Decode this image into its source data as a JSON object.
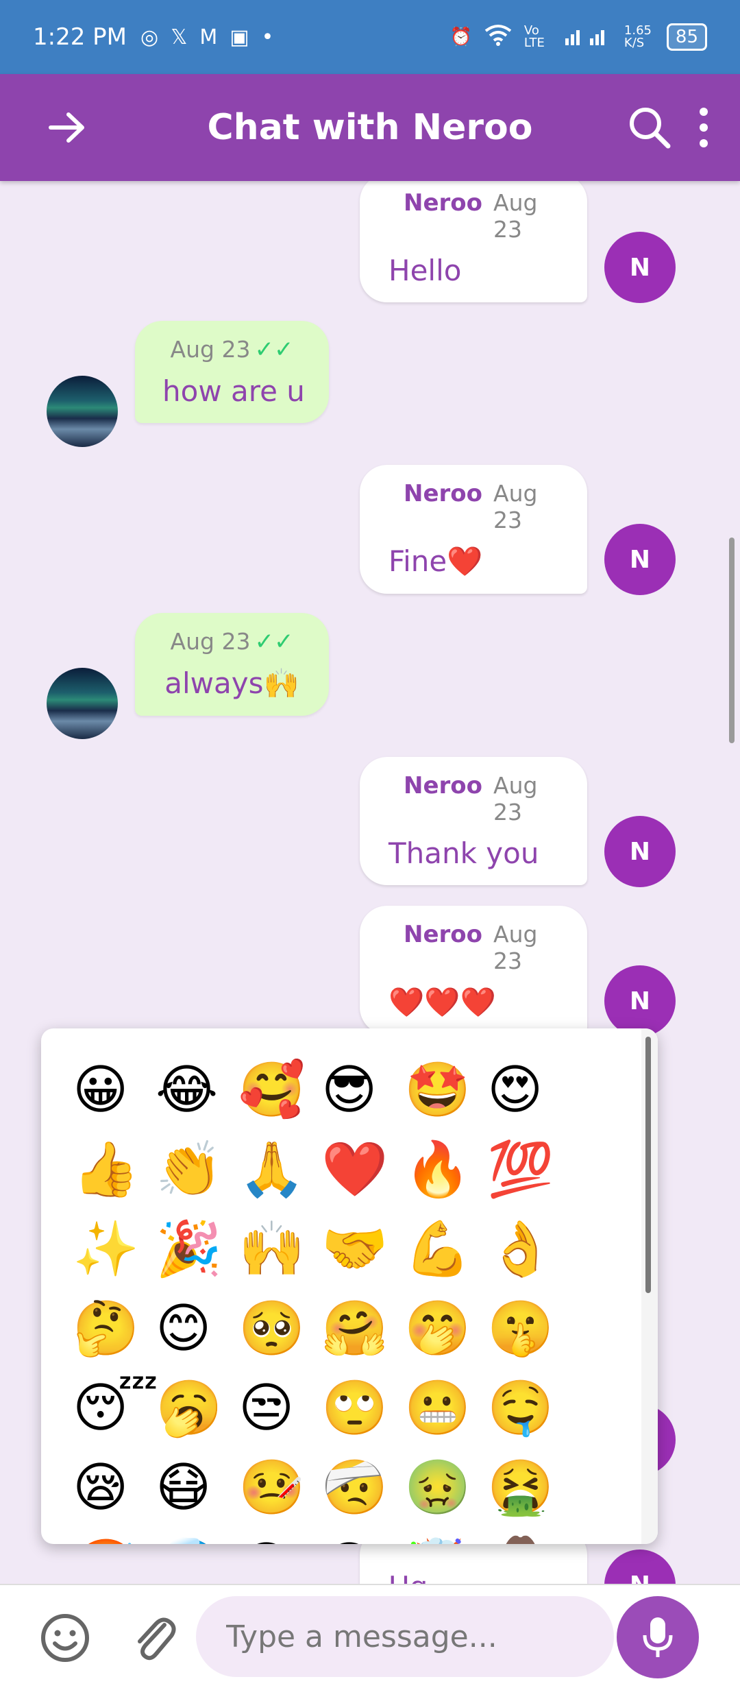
{
  "status_bar": {
    "time": "1:22 PM",
    "network": "Vo LTE",
    "speed": "1.65 K/S",
    "battery": "85"
  },
  "app_bar": {
    "title": "Chat with Neroo"
  },
  "messages": [
    {
      "type": "out",
      "sender": "Neroo",
      "date": "Aug 23",
      "text": "Hello",
      "avatar": "N"
    },
    {
      "type": "in",
      "date": "Aug 23",
      "check": "✓✓",
      "text": "how are u"
    },
    {
      "type": "out",
      "sender": "Neroo",
      "date": "Aug 23",
      "text": "Fine❤️",
      "avatar": "N"
    },
    {
      "type": "in",
      "date": "Aug 23",
      "check": "✓✓",
      "text": "always🙌"
    },
    {
      "type": "out",
      "sender": "Neroo",
      "date": "Aug 23",
      "text": "Thank you",
      "avatar": "N"
    },
    {
      "type": "out",
      "sender": "Neroo",
      "date": "Aug 23",
      "text": "❤️❤️❤️",
      "avatar": "N"
    },
    {
      "type": "out",
      "text": "Ug",
      "avatar": "N"
    }
  ],
  "emoji_picker": {
    "rows": [
      [
        "😀",
        "😂",
        "🥰",
        "😎",
        "🤩",
        "😍"
      ],
      [
        "👍",
        "👏",
        "🙏",
        "❤️",
        "🔥",
        "💯"
      ],
      [
        "✨",
        "🎉",
        "🙌",
        "🤝",
        "💪",
        "👌"
      ],
      [
        "🤔",
        "😊",
        "🥺",
        "🤗",
        "🤭",
        "🤫"
      ],
      [
        "😴",
        "🥱",
        "😒",
        "🙄",
        "😬",
        "🤤"
      ],
      [
        "😪",
        "😷",
        "🤒",
        "🤕",
        "🤢",
        "🤮"
      ],
      [
        "🥵",
        "🥶",
        "😵",
        "😐",
        "🤯",
        "🤠"
      ]
    ]
  },
  "input": {
    "placeholder": "Type a message..."
  },
  "colors": {
    "status_bar": "#3e7fc2",
    "app_bar": "#8e44ad",
    "chat_bg": "#f1e9f6",
    "bubble_in": "#defbc8",
    "avatar": "#9b2fb5"
  },
  "icons": {
    "back": "arrow-right-icon",
    "search": "search-icon",
    "more": "more-vert-icon",
    "emoji": "smiley-icon",
    "attach": "paperclip-icon",
    "mic": "mic-icon"
  }
}
